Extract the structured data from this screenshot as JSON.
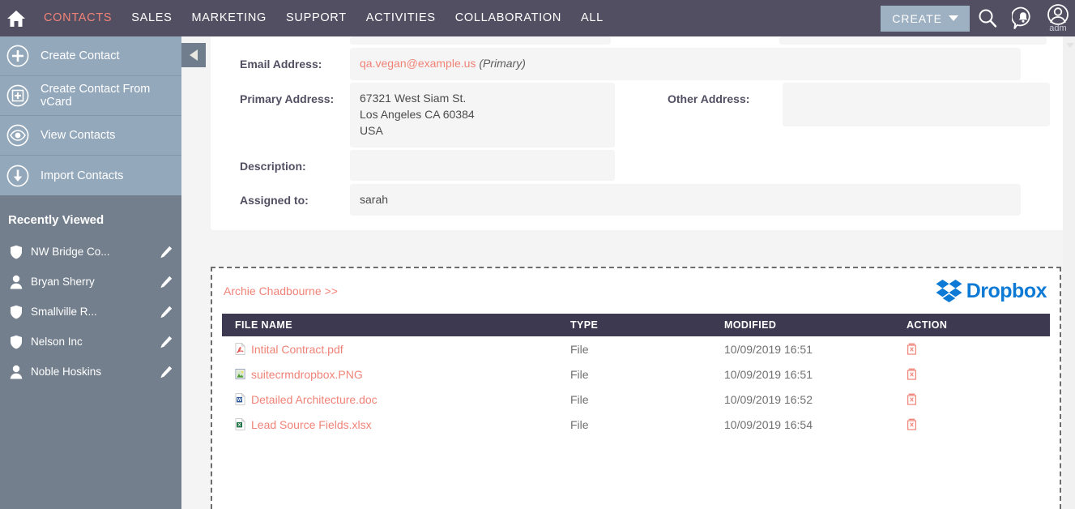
{
  "navbar": {
    "home_icon": "home-icon",
    "links": [
      {
        "label": "CONTACTS",
        "active": true
      },
      {
        "label": "SALES",
        "active": false
      },
      {
        "label": "MARKETING",
        "active": false
      },
      {
        "label": "SUPPORT",
        "active": false
      },
      {
        "label": "ACTIVITIES",
        "active": false
      },
      {
        "label": "COLLABORATION",
        "active": false
      },
      {
        "label": "ALL",
        "active": false
      }
    ],
    "create_label": "CREATE",
    "search_icon": "search-icon",
    "notifications_icon": "notification-bell-icon",
    "avatar_icon": "user-avatar-icon",
    "avatar_name": "adm",
    "accent_color": "#f08377",
    "bg_color": "#534f62",
    "create_bg_color": "#9eb1c3"
  },
  "sidebar": {
    "actions": [
      {
        "label": "Create Contact",
        "icon": "plus-circle-icon"
      },
      {
        "label": "Create Contact From vCard",
        "icon": "plus-square-circle-icon"
      },
      {
        "label": "View Contacts",
        "icon": "eye-circle-icon"
      },
      {
        "label": "Import Contacts",
        "icon": "download-arrow-circle-icon"
      }
    ],
    "recently_viewed_title": "Recently Viewed",
    "recently_viewed": [
      {
        "label": "NW Bridge Co...",
        "icon": "shield-icon",
        "edit_icon": "pencil-icon"
      },
      {
        "label": "Bryan Sherry",
        "icon": "person-icon",
        "edit_icon": "pencil-icon"
      },
      {
        "label": "Smallville R...",
        "icon": "shield-icon",
        "edit_icon": "pencil-icon"
      },
      {
        "label": "Nelson Inc",
        "icon": "shield-icon",
        "edit_icon": "pencil-icon"
      },
      {
        "label": "Noble Hoskins",
        "icon": "person-icon",
        "edit_icon": "pencil-icon"
      }
    ],
    "collapse_icon": "collapse-left-icon",
    "bg_color": "#737f8c",
    "actions_bg_color": "#94a8bc"
  },
  "detail": {
    "fields": [
      {
        "label": "Email Address:",
        "value_link": "qa.vegan@example.us",
        "value_suffix": "(Primary)"
      },
      {
        "label": "Primary Address:",
        "value": "67321 West Siam St.\nLos Angeles CA   60384\nUSA"
      },
      {
        "label": "Description:",
        "value": ""
      },
      {
        "label": "Assigned to:",
        "value": "sarah"
      }
    ],
    "right_fields": [
      {
        "label": "Other Address:",
        "value": ""
      }
    ]
  },
  "dropbox_panel": {
    "breadcrumb": "Archie Chadbourne >>",
    "logo_text": "Dropbox",
    "logo_icon": "dropbox-logo-icon",
    "logo_color": "#0d7ad6",
    "columns": [
      "FILE NAME",
      "TYPE",
      "MODIFIED",
      "ACTION"
    ],
    "rows": [
      {
        "name": "Intital Contract.pdf",
        "icon": "pdf-file-icon",
        "type": "File",
        "modified": "10/09/2019 16:51",
        "action_icon": "trash-icon"
      },
      {
        "name": "suitecrmdropbox.PNG",
        "icon": "image-file-icon",
        "type": "File",
        "modified": "10/09/2019 16:51",
        "action_icon": "trash-icon"
      },
      {
        "name": "Detailed Architecture.doc",
        "icon": "word-file-icon",
        "type": "File",
        "modified": "10/09/2019 16:52",
        "action_icon": "trash-icon"
      },
      {
        "name": "Lead Source Fields.xlsx",
        "icon": "excel-file-icon",
        "type": "File",
        "modified": "10/09/2019 16:54",
        "action_icon": "trash-icon"
      }
    ],
    "header_bg_color": "#3c3950",
    "link_color": "#f08377"
  }
}
